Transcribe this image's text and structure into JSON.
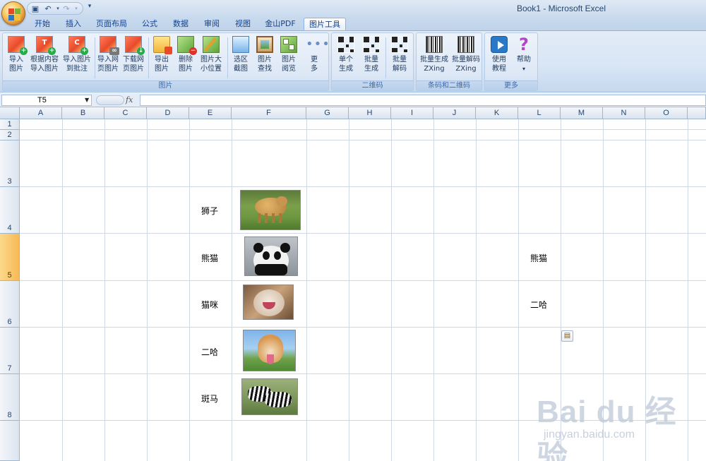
{
  "window": {
    "title": "Book1 - Microsoft Excel"
  },
  "tabs": [
    {
      "label": "开始"
    },
    {
      "label": "插入"
    },
    {
      "label": "页面布局"
    },
    {
      "label": "公式"
    },
    {
      "label": "数据"
    },
    {
      "label": "审阅"
    },
    {
      "label": "视图"
    },
    {
      "label": "金山PDF"
    },
    {
      "label": "图片工具",
      "active": true
    }
  ],
  "ribbon": {
    "groups": [
      {
        "label": "图片"
      },
      {
        "label": "二维码"
      },
      {
        "label": "条码和二维码"
      },
      {
        "label": "更多"
      }
    ],
    "buttons": {
      "import_picture": [
        "导入",
        "图片"
      ],
      "import_by_content": [
        "根据内容",
        "导入图片"
      ],
      "import_to_comment": [
        "导入图片",
        "到批注"
      ],
      "import_web_picture": [
        "导入网",
        "页图片"
      ],
      "download_web_picture": [
        "下载网",
        "页图片"
      ],
      "export_picture": [
        "导出",
        "图片"
      ],
      "delete_picture": [
        "删除",
        "图片"
      ],
      "picture_size_position": [
        "图片大",
        "小位置"
      ],
      "select_area_screenshot": [
        "选区",
        "截图"
      ],
      "picture_find": [
        "图片",
        "查找"
      ],
      "picture_browse": [
        "图片",
        "阅览"
      ],
      "more": [
        "更",
        "多"
      ],
      "single_generate": [
        "单个",
        "生成"
      ],
      "batch_generate": [
        "批量",
        "生成"
      ],
      "batch_decode": [
        "批量",
        "解码"
      ],
      "zxing_generate": [
        "批量生成",
        "ZXing"
      ],
      "zxing_decode": [
        "批量解码",
        "ZXing"
      ],
      "tutorial": [
        "使用",
        "教程"
      ],
      "help": [
        "帮助",
        "▾"
      ]
    }
  },
  "formula_bar": {
    "name_box": "T5",
    "fx_label": "fx",
    "formula": ""
  },
  "grid": {
    "columns": [
      "A",
      "B",
      "C",
      "D",
      "E",
      "F",
      "G",
      "H",
      "I",
      "J",
      "K",
      "L",
      "M",
      "N",
      "O"
    ],
    "rows": [
      "1",
      "2",
      "3",
      "4",
      "5",
      "6",
      "7",
      "8"
    ],
    "selected_row": "5",
    "cells": {
      "E4": "狮子",
      "E5": "熊猫",
      "E6": "猫咪",
      "E7": "二哈",
      "E8": "斑马",
      "L5": "熊猫",
      "L6": "二哈"
    },
    "pictures": [
      {
        "name": "lion",
        "cell": "F4"
      },
      {
        "name": "panda",
        "cell": "F5"
      },
      {
        "name": "cat",
        "cell": "F6"
      },
      {
        "name": "husky",
        "cell": "F7"
      },
      {
        "name": "zebra",
        "cell": "F8"
      }
    ]
  },
  "watermark": {
    "brand": "Bai du 经验",
    "url": "jingyan.baidu.com"
  },
  "colors": {
    "accent": "#15428b",
    "selected_row_header": "#f7b955",
    "gridline": "#d0d7e5"
  }
}
